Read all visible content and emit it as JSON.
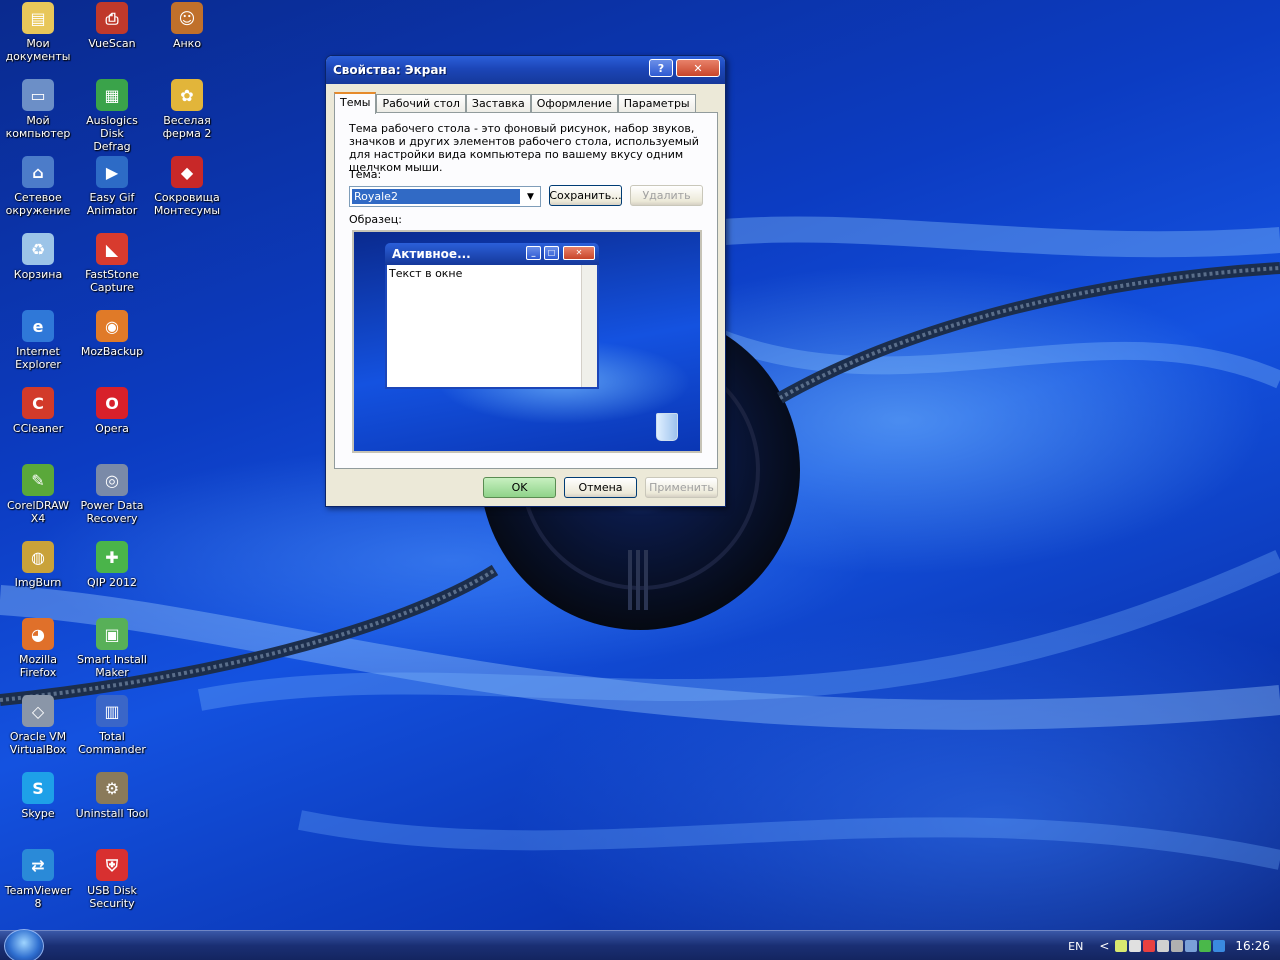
{
  "desktop": {
    "icons": [
      {
        "label": "Мои\nдокументы",
        "icon": "my-documents-icon",
        "color": "#e8c75a",
        "glyph": "▤"
      },
      {
        "label": "VueScan",
        "icon": "vuescan-icon",
        "color": "#c0392b",
        "glyph": "⎙"
      },
      {
        "label": "Анко",
        "icon": "anko-icon",
        "color": "#c0702b",
        "glyph": "☺"
      },
      {
        "label": "Мой\nкомпьютер",
        "icon": "my-computer-icon",
        "color": "#6c8fc7",
        "glyph": "▭"
      },
      {
        "label": "Auslogics Disk\nDefrag",
        "icon": "auslogics-defrag-icon",
        "color": "#3aa34a",
        "glyph": "▦"
      },
      {
        "label": "Веселая\nферма 2",
        "icon": "funny-farm-icon",
        "color": "#e2b53a",
        "glyph": "✿"
      },
      {
        "label": "Сетевое\nокружение",
        "icon": "network-icon",
        "color": "#4c7cc9",
        "glyph": "⌂"
      },
      {
        "label": "Easy Gif\nAnimator",
        "icon": "easy-gif-animator-icon",
        "color": "#2d6bc6",
        "glyph": "▶"
      },
      {
        "label": "Сокровища\nМонтесумы",
        "icon": "montezuma-icon",
        "color": "#c82828",
        "glyph": "◆"
      },
      {
        "label": "Корзина",
        "icon": "recycle-bin-icon",
        "color": "#9cc4e8",
        "glyph": "♻"
      },
      {
        "label": "FastStone\nCapture",
        "icon": "faststone-capture-icon",
        "color": "#d83b2e",
        "glyph": "◣"
      },
      {
        "label": "Internet\nExplorer",
        "icon": "internet-explorer-icon",
        "color": "#2f78d8",
        "glyph": "e"
      },
      {
        "label": "MozBackup",
        "icon": "mozbackup-icon",
        "color": "#e07a28",
        "glyph": "◉"
      },
      {
        "label": "CCleaner",
        "icon": "ccleaner-icon",
        "color": "#d23a2a",
        "glyph": "C"
      },
      {
        "label": "Opera",
        "icon": "opera-icon",
        "color": "#d8202a",
        "glyph": "O"
      },
      {
        "label": "CorelDRAW X4",
        "icon": "coreldraw-icon",
        "color": "#5aa83a",
        "glyph": "✎"
      },
      {
        "label": "Power Data\nRecovery",
        "icon": "power-data-recovery-icon",
        "color": "#7a8aa8",
        "glyph": "◎"
      },
      {
        "label": "ImgBurn",
        "icon": "imgburn-icon",
        "color": "#c9a23a",
        "glyph": "◍"
      },
      {
        "label": "QIP 2012",
        "icon": "qip-icon",
        "color": "#4ab44a",
        "glyph": "✚"
      },
      {
        "label": "Mozilla Firefox",
        "icon": "firefox-icon",
        "color": "#e0702a",
        "glyph": "◕"
      },
      {
        "label": "Smart Install\nMaker",
        "icon": "smart-install-maker-icon",
        "color": "#58b058",
        "glyph": "▣"
      },
      {
        "label": "Oracle VM\nVirtualBox",
        "icon": "virtualbox-icon",
        "color": "#8a96a8",
        "glyph": "◇"
      },
      {
        "label": "Total\nCommander",
        "icon": "total-commander-icon",
        "color": "#3a66c8",
        "glyph": "▥"
      },
      {
        "label": "Skype",
        "icon": "skype-icon",
        "color": "#1ea0e8",
        "glyph": "S"
      },
      {
        "label": "Uninstall Tool",
        "icon": "uninstall-tool-icon",
        "color": "#8a7a5a",
        "glyph": "⚙"
      },
      {
        "label": "TeamViewer 8",
        "icon": "teamviewer-icon",
        "color": "#2a8ad8",
        "glyph": "⇄"
      },
      {
        "label": "USB Disk\nSecurity",
        "icon": "usb-disk-security-icon",
        "color": "#d83030",
        "glyph": "⛨"
      }
    ]
  },
  "dialog": {
    "title": "Свойства: Экран",
    "help_glyph": "?",
    "close_glyph": "✕",
    "tabs": [
      "Темы",
      "Рабочий стол",
      "Заставка",
      "Оформление",
      "Параметры"
    ],
    "active_tab": "Темы",
    "description": "Тема рабочего стола - это фоновый рисунок, набор звуков, значков и других элементов рабочего стола, используемый для настройки вида компьютера по вашему вкусу одним щелчком мыши.",
    "theme_label": "Тема:",
    "theme_value": "Royale2",
    "save_button": "Сохранить...",
    "delete_button": "Удалить",
    "sample_label": "Образец:",
    "preview": {
      "window_title": "Активное...",
      "window_text": "Текст в окне"
    },
    "ok_button": "OK",
    "cancel_button": "Отмена",
    "apply_button": "Применить"
  },
  "taskbar": {
    "language": "EN",
    "tray_chevron": "<",
    "clock": "16:26",
    "tray_icons": [
      {
        "icon": "tray-icon-1",
        "color": "#d8e870"
      },
      {
        "icon": "tray-icon-2",
        "color": "#e0e0e0"
      },
      {
        "icon": "tray-icon-3",
        "color": "#e84040"
      },
      {
        "icon": "tray-icon-4",
        "color": "#d0d0d0"
      },
      {
        "icon": "tray-icon-5",
        "color": "#b0b0b0"
      },
      {
        "icon": "tray-icon-6",
        "color": "#7aa0d8"
      },
      {
        "icon": "tray-icon-7",
        "color": "#4ab84a"
      },
      {
        "icon": "tray-icon-8",
        "color": "#3a8ae0"
      }
    ]
  }
}
